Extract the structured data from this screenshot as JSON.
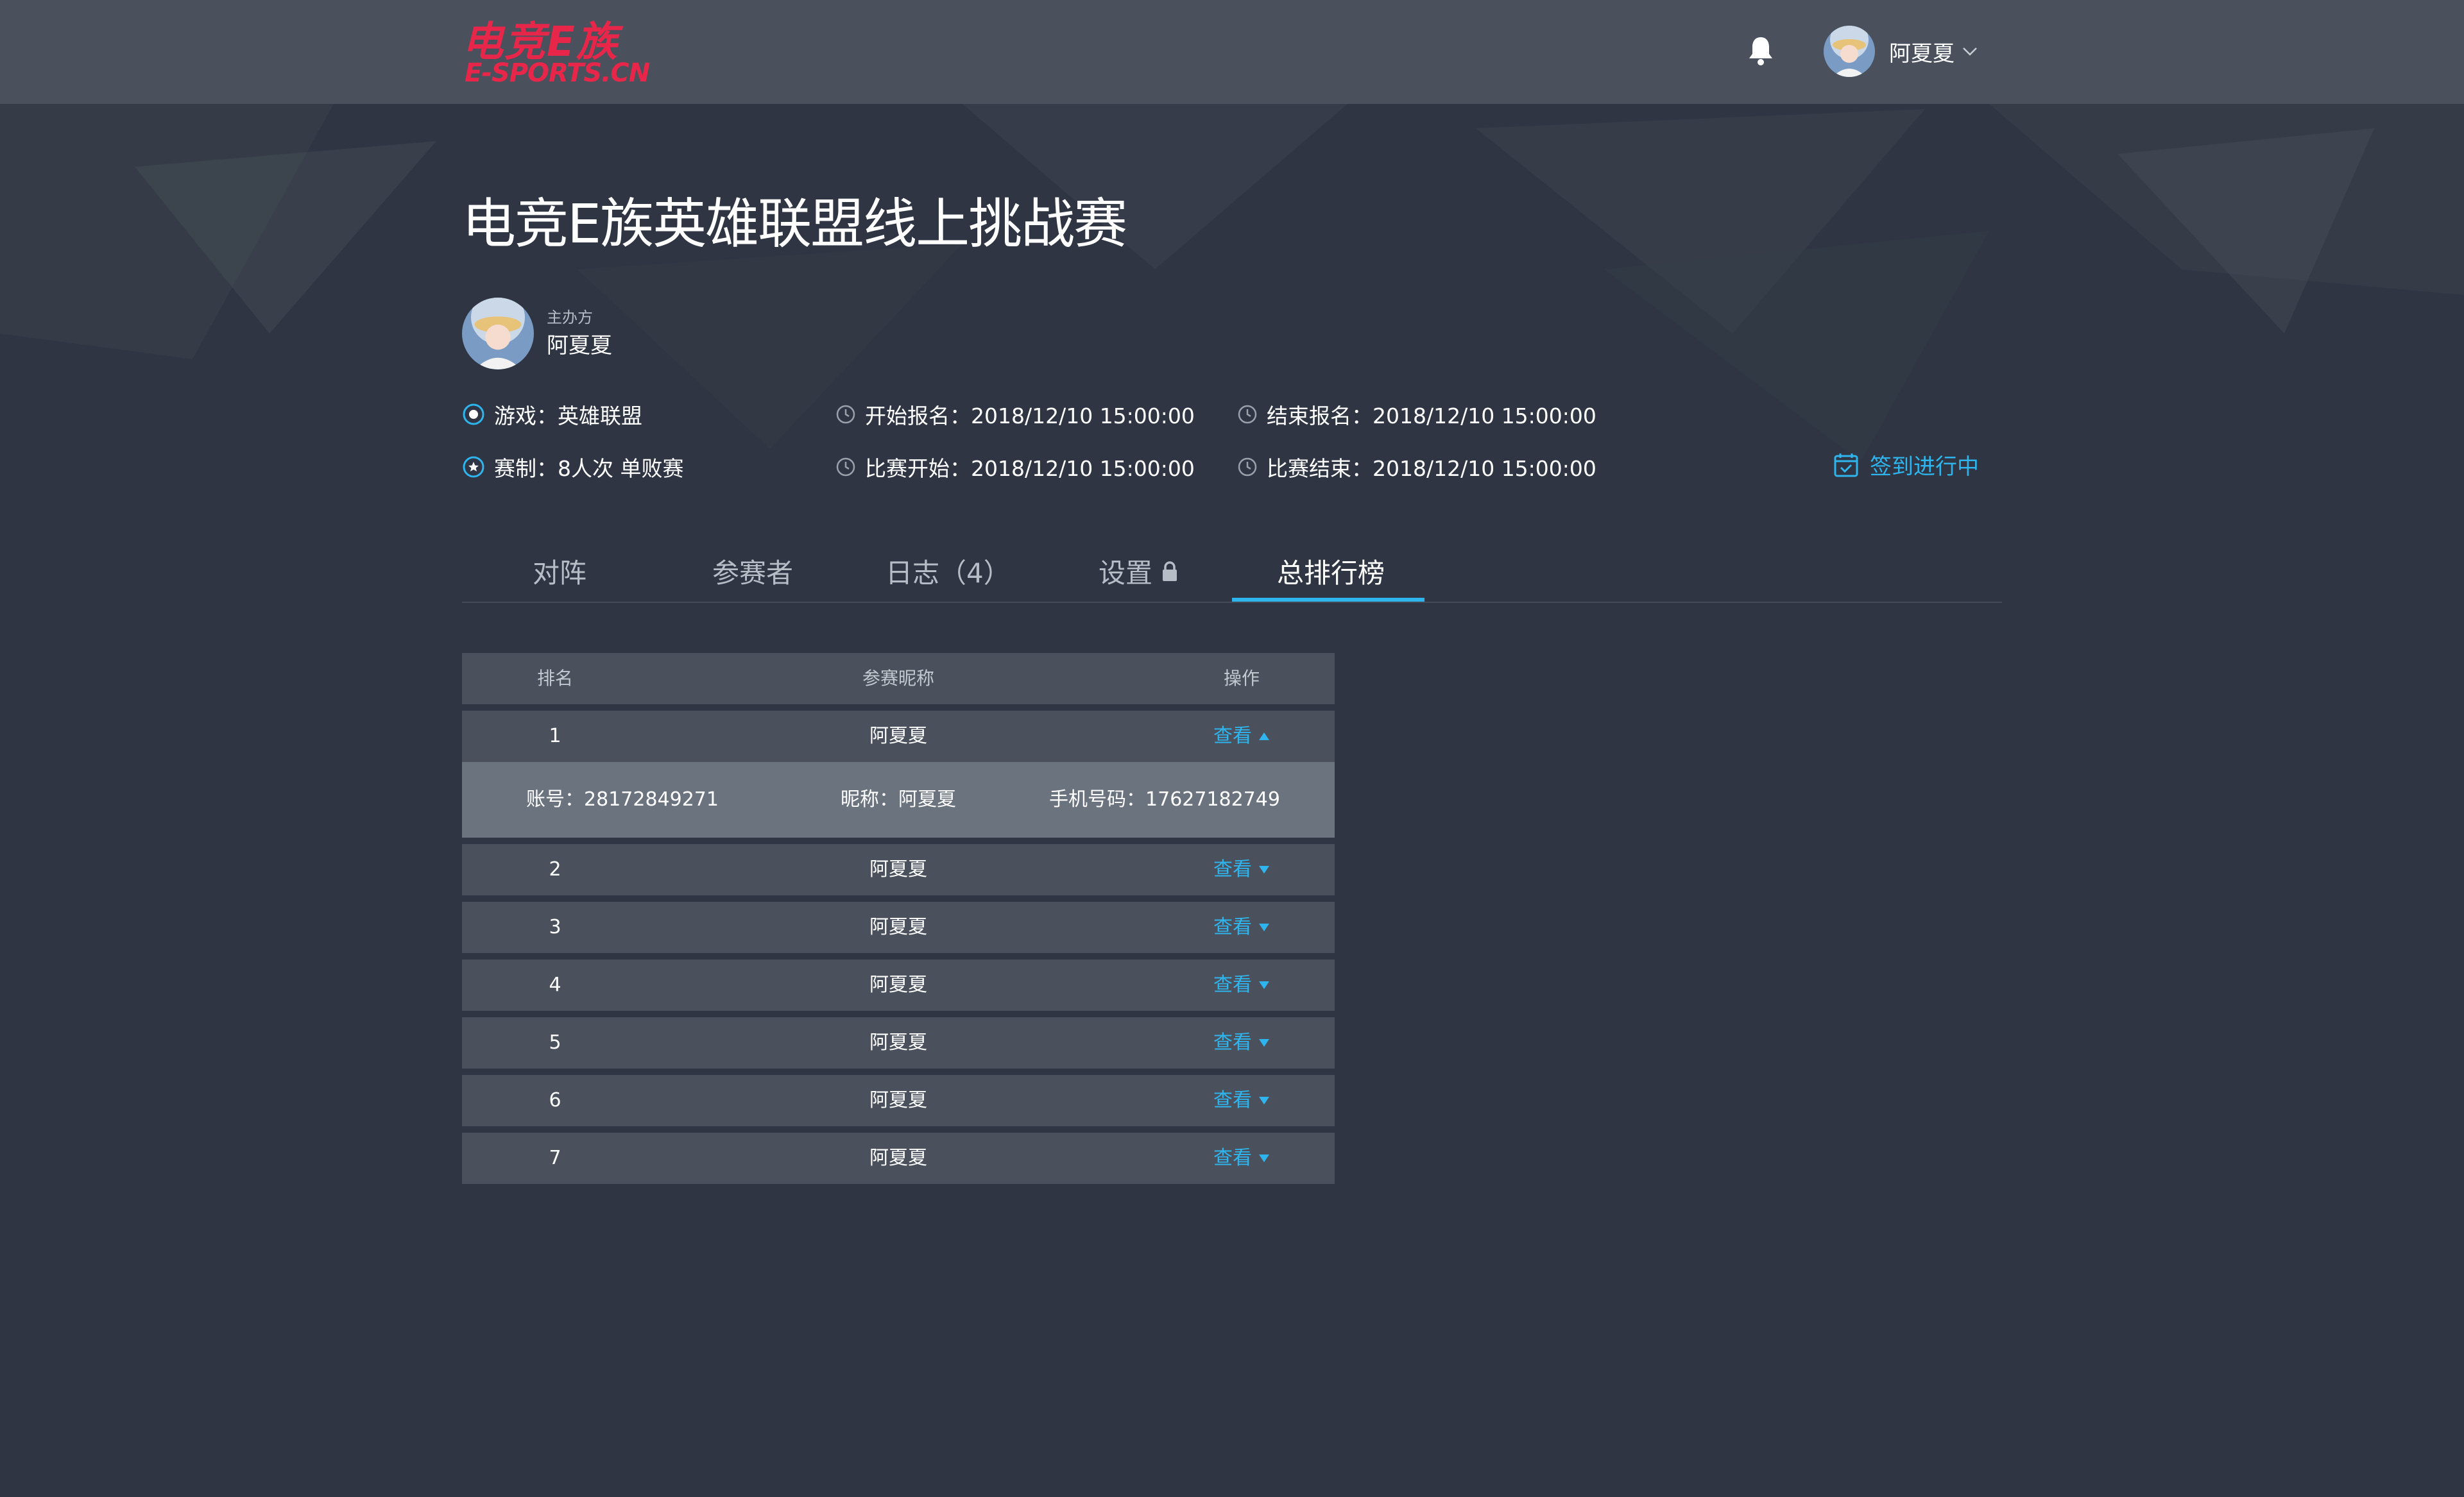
{
  "brand": {
    "logo_cn": "电竞E族",
    "logo_en": "E-SPORTS.CN"
  },
  "header": {
    "user_name": "阿夏夏"
  },
  "event": {
    "title": "电竞E族英雄联盟线上挑战赛",
    "organizer_label": "主办方",
    "organizer_name": "阿夏夏",
    "game": "游戏：英雄联盟",
    "format": "赛制：8人次  单败赛",
    "registration_start": "开始报名：2018/12/10  15:00:00",
    "registration_end": "结束报名：2018/12/10  15:00:00",
    "match_start": "比赛开始：2018/12/10  15:00:00",
    "match_end": "比赛结束：2018/12/10  15:00:00",
    "checkin_status": "签到进行中"
  },
  "tabs": [
    {
      "label": "对阵"
    },
    {
      "label": "参赛者"
    },
    {
      "label": "日志（4）"
    },
    {
      "label": "设置"
    },
    {
      "label": "总排行榜"
    }
  ],
  "active_tab": "总排行榜",
  "ranking": {
    "headers": [
      "排名",
      "参赛昵称",
      "操作"
    ],
    "view_label": "查看",
    "rows": [
      {
        "rank": "1",
        "name": "阿夏夏",
        "expanded": true
      },
      {
        "rank": "2",
        "name": "阿夏夏",
        "expanded": false
      },
      {
        "rank": "3",
        "name": "阿夏夏",
        "expanded": false
      },
      {
        "rank": "4",
        "name": "阿夏夏",
        "expanded": false
      },
      {
        "rank": "5",
        "name": "阿夏夏",
        "expanded": false
      },
      {
        "rank": "6",
        "name": "阿夏夏",
        "expanded": false
      },
      {
        "rank": "7",
        "name": "阿夏夏",
        "expanded": false
      }
    ],
    "detail": {
      "account": "账号：28172849271",
      "nickname": "昵称：阿夏夏",
      "phone": "手机号码：17627182749"
    }
  },
  "colors": {
    "background": "#2f3542",
    "topbar": "#4a515c",
    "accent": "#2fb5ee",
    "brand": "#e8264a",
    "row": "#4a515c",
    "detail_row": "#6b737f"
  },
  "icons": [
    "bell-icon",
    "chevron-down-icon",
    "radio-dot-icon",
    "star-circle-icon",
    "clock-icon",
    "calendar-check-icon",
    "lock-icon",
    "caret-up-icon",
    "caret-down-icon"
  ]
}
